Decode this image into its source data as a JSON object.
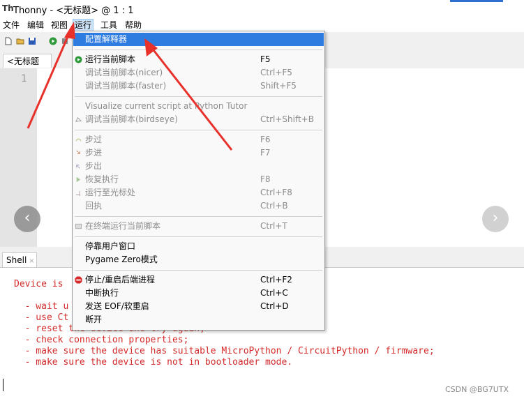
{
  "window": {
    "app_icon": "Th",
    "title": "Thonny - <无标题> @ 1 : 1"
  },
  "menubar": {
    "items": [
      "文件",
      "编辑",
      "视图",
      "运行",
      "工具",
      "帮助"
    ],
    "active_index": 3
  },
  "toolbar": {
    "icons": [
      "new-file-icon",
      "open-folder-icon",
      "save-icon",
      "run-icon"
    ]
  },
  "editor": {
    "tab_label": "<无标题>",
    "tab_close": "×",
    "line_number": "1",
    "nav_left": "‹",
    "nav_right": "›"
  },
  "shell": {
    "tab_label": "Shell",
    "tab_close": "×",
    "lines": [
      "Device is",
      "",
      "  - wait u",
      "  - use Ct",
      "  - reset the device and try again;",
      "  - check connection properties;",
      "  - make sure the device has suitable MicroPython / CircuitPython / firmware;",
      "  - make sure the device is not in bootloader mode."
    ]
  },
  "run_menu": {
    "items": [
      {
        "label": "配置解释器",
        "shortcut": "",
        "highlighted": true,
        "disabled": false,
        "icon": ""
      },
      {
        "separator": true
      },
      {
        "label": "运行当前脚本",
        "shortcut": "F5",
        "disabled": false,
        "icon": "run-icon"
      },
      {
        "label": "调试当前脚本(nicer)",
        "shortcut": "Ctrl+F5",
        "disabled": true,
        "icon": ""
      },
      {
        "label": "调试当前脚本(faster)",
        "shortcut": "Shift+F5",
        "disabled": true,
        "icon": ""
      },
      {
        "separator": true
      },
      {
        "label": "Visualize current script at Python Tutor",
        "shortcut": "",
        "disabled": true,
        "icon": ""
      },
      {
        "label": "调试当前脚本(birdseye)",
        "shortcut": "Ctrl+Shift+B",
        "disabled": true,
        "icon": "birdseye-icon"
      },
      {
        "separator": true
      },
      {
        "label": "步过",
        "shortcut": "F6",
        "disabled": true,
        "icon": "step-over-icon"
      },
      {
        "label": "步进",
        "shortcut": "F7",
        "disabled": true,
        "icon": "step-into-icon"
      },
      {
        "label": "步出",
        "shortcut": "",
        "disabled": true,
        "icon": "step-out-icon"
      },
      {
        "label": "恢复执行",
        "shortcut": "F8",
        "disabled": true,
        "icon": "resume-icon"
      },
      {
        "label": "运行至光标处",
        "shortcut": "Ctrl+F8",
        "disabled": true,
        "icon": "run-to-cursor-icon"
      },
      {
        "label": "回执",
        "shortcut": "Ctrl+B",
        "disabled": true,
        "icon": ""
      },
      {
        "separator": true
      },
      {
        "label": "在终端运行当前脚本",
        "shortcut": "Ctrl+T",
        "disabled": true,
        "icon": "terminal-icon"
      },
      {
        "separator": true
      },
      {
        "label": "停靠用户窗口",
        "shortcut": "",
        "disabled": false,
        "icon": ""
      },
      {
        "label": "Pygame Zero模式",
        "shortcut": "",
        "disabled": false,
        "icon": ""
      },
      {
        "separator": true
      },
      {
        "label": "停止/重启后端进程",
        "shortcut": "Ctrl+F2",
        "disabled": false,
        "icon": "stop-icon"
      },
      {
        "label": "中断执行",
        "shortcut": "Ctrl+C",
        "disabled": false,
        "icon": ""
      },
      {
        "label": "发送 EOF/软重启",
        "shortcut": "Ctrl+D",
        "disabled": false,
        "icon": ""
      },
      {
        "label": "断开",
        "shortcut": "",
        "disabled": false,
        "icon": ""
      }
    ]
  },
  "watermark": "CSDN @BG7UTX",
  "colors": {
    "highlight": "#2f7ce0",
    "annotation_arrow": "#e8312a",
    "error_text": "#d42a2a",
    "menu_active": "#cde3f8"
  }
}
